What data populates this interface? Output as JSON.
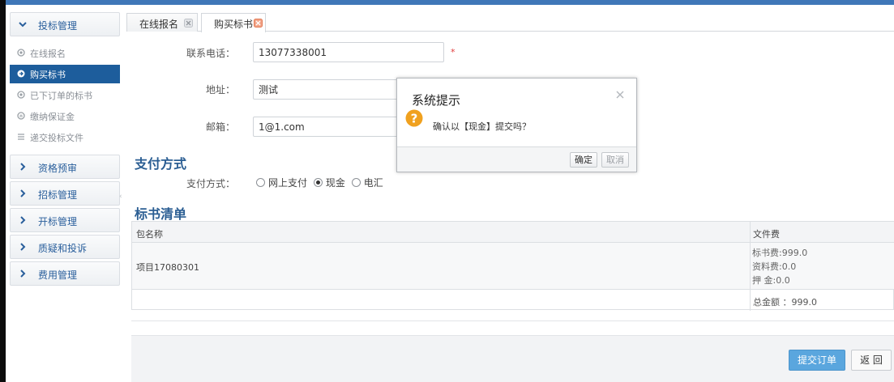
{
  "sidebar": {
    "bid_management": "投标管理",
    "sub_items": [
      "在线报名",
      "购买标书",
      "已下订单的标书",
      "缴纳保证金",
      "递交投标文件"
    ],
    "sections": [
      "资格预审",
      "招标管理",
      "开标管理",
      "质疑和投诉",
      "费用管理"
    ],
    "active_index": 1
  },
  "tabs": [
    {
      "label": "在线报名"
    },
    {
      "label": "购买标书"
    }
  ],
  "form": {
    "phone_label": "联系电话：",
    "phone_value": "13077338001",
    "required_mark": "*",
    "address_label": "地址：",
    "address_value": "测试",
    "email_label": "邮箱：",
    "email_value": "1@1.com"
  },
  "payment": {
    "section_title": "支付方式",
    "label": "支付方式：",
    "options": [
      "网上支付",
      "现金",
      "电汇"
    ],
    "selected": "现金"
  },
  "bid_list": {
    "section_title": "标书清单",
    "col_package": "包名称",
    "col_fee": "文件费",
    "rows": [
      {
        "package": "项目17080301",
        "fees": [
          "标书费:999.0",
          "资料费:0.0",
          "押 金:0.0"
        ]
      }
    ],
    "total": "总金额 ：999.0"
  },
  "footer": {
    "submit_label": "提交订单",
    "back_label": "返 回"
  },
  "dialog": {
    "title": "系统提示",
    "message": "确认以【现金】提交吗？",
    "ok_label": "确定",
    "cancel_label": "取消"
  },
  "colors": {
    "accent": "#1d5d9c",
    "title_blue": "#2b5e93",
    "submit_blue": "#5aa6de",
    "warning_orange": "#f0a11f"
  }
}
